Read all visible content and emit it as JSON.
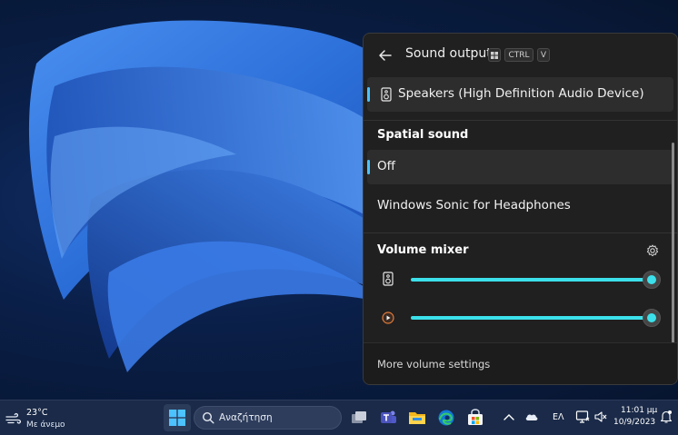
{
  "flyout": {
    "title": "Sound output",
    "shortcut_keys": [
      "CTRL",
      "V"
    ],
    "output_device": "Speakers (High Definition Audio Device)",
    "spatial_sound": {
      "heading": "Spatial sound",
      "options": [
        {
          "label": "Off",
          "selected": true
        },
        {
          "label": "Windows Sonic for Headphones",
          "selected": false
        }
      ]
    },
    "volume_mixer": {
      "heading": "Volume mixer",
      "sliders": [
        {
          "icon": "speaker-icon",
          "level": 1.0
        },
        {
          "icon": "media-player-icon",
          "level": 1.0
        }
      ]
    },
    "footer_link": "More volume settings"
  },
  "taskbar": {
    "weather": {
      "temperature": "23°C",
      "description": "Με άνεμο"
    },
    "search_placeholder": "Αναζήτηση",
    "pinned_apps": [
      "task-view-icon",
      "teams-icon",
      "file-explorer-icon",
      "edge-icon",
      "store-icon"
    ],
    "tray": {
      "language": "ΕΛ",
      "time": "11:01 μμ",
      "date": "10/9/2023"
    }
  },
  "colors": {
    "accent": "#4cc2ff",
    "slider": "#3be0ea",
    "panel_bg": "#202020"
  }
}
